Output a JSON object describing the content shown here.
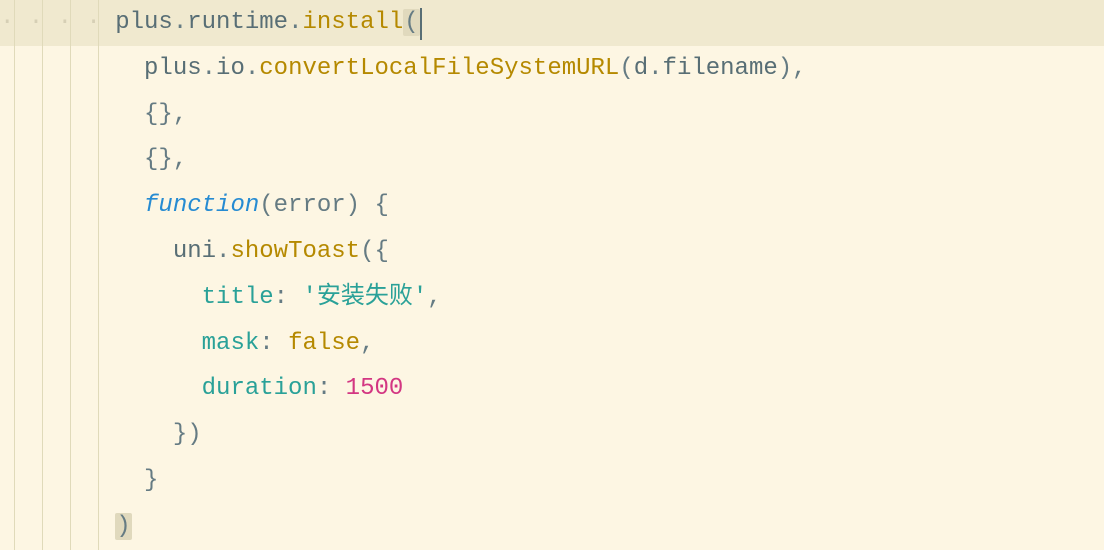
{
  "code": {
    "line1": {
      "obj1": "plus",
      "dot1": ".",
      "prop1": "runtime",
      "dot2": ".",
      "method": "install",
      "paren": "("
    },
    "line2": {
      "obj1": "plus",
      "dot1": ".",
      "prop1": "io",
      "dot2": ".",
      "method": "convertLocalFileSystemURL",
      "paren1": "(",
      "obj2": "d",
      "dot3": ".",
      "prop2": "filename",
      "paren2": ")",
      "comma": ","
    },
    "line3": {
      "braces": "{}",
      "comma": ","
    },
    "line4": {
      "braces": "{}",
      "comma": ","
    },
    "line5": {
      "keyword": "function",
      "paren1": "(",
      "param": "error",
      "paren2": ")",
      "brace": " {"
    },
    "line6": {
      "obj": "uni",
      "dot": ".",
      "method": "showToast",
      "paren": "(",
      "brace": "{"
    },
    "line7": {
      "key": "title",
      "colon": ": ",
      "value": "'安装失败'",
      "comma": ","
    },
    "line8": {
      "key": "mask",
      "colon": ": ",
      "value": "false",
      "comma": ","
    },
    "line9": {
      "key": "duration",
      "colon": ": ",
      "value": "1500"
    },
    "line10": {
      "brace": "}",
      "paren": ")"
    },
    "line11": {
      "brace": "}"
    },
    "line12": {
      "paren": ")"
    }
  }
}
